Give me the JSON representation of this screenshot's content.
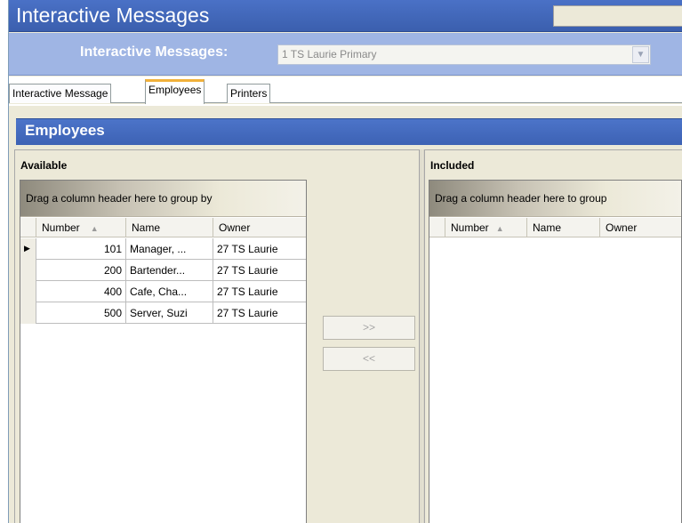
{
  "window": {
    "title": "Interactive Messages"
  },
  "selector": {
    "label": "Interactive Messages:",
    "value": "1  TS Laurie Primary"
  },
  "tabs": [
    {
      "label": "Interactive Message",
      "active": false
    },
    {
      "label": "Employees",
      "active": true
    },
    {
      "label": "Printers",
      "active": false
    }
  ],
  "section": {
    "title": "Employees"
  },
  "available": {
    "label": "Available",
    "group_hint": "Drag a column header here to group by",
    "columns": [
      "Number",
      "Name",
      "Owner"
    ],
    "rows": [
      {
        "number": "101",
        "name": "Manager, ...",
        "owner": "27  TS Laurie",
        "current": true
      },
      {
        "number": "200",
        "name": "Bartender...",
        "owner": "27  TS Laurie",
        "current": false
      },
      {
        "number": "400",
        "name": "Cafe, Cha...",
        "owner": "27  TS Laurie",
        "current": false
      },
      {
        "number": "500",
        "name": "Server, Suzi",
        "owner": "27  TS Laurie",
        "current": false
      }
    ]
  },
  "included": {
    "label": "Included",
    "group_hint": "Drag a column header here to group",
    "columns": [
      "Number",
      "Name",
      "Owner"
    ],
    "rows": []
  },
  "buttons": {
    "add": ">>",
    "remove": "<<"
  },
  "icons": {
    "dropdown": "chevron-down-icon",
    "sort": "sort-ascending-icon",
    "row_pointer": "row-indicator-icon"
  }
}
